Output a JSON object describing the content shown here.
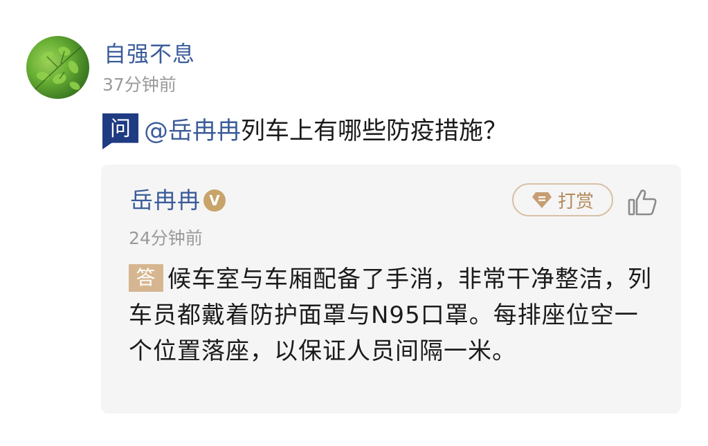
{
  "post": {
    "author": "自强不息",
    "time": "37分钟前",
    "question_badge": "问",
    "mention": "@岳冉冉",
    "question_text": "列车上有哪些防疫措施？"
  },
  "answer": {
    "author": "岳冉冉",
    "verified_badge": "V",
    "time": "24分钟前",
    "tip_label": "打赏",
    "answer_badge": "答",
    "text": "候车室与车厢配备了手消，非常干净整洁，列车员都戴着防护面罩与N95口罩。每排座位空一个位置落座，以保证人员间隔一米。"
  },
  "icons": {
    "tip": "diamond-tip-icon",
    "like": "thumbs-up-icon"
  },
  "colors": {
    "link_blue": "#3b5c9a",
    "question_badge": "#1f3b82",
    "answer_badge": "#d6b690",
    "tip_gold": "#b58a5c",
    "card_bg": "#f5f5f5"
  }
}
